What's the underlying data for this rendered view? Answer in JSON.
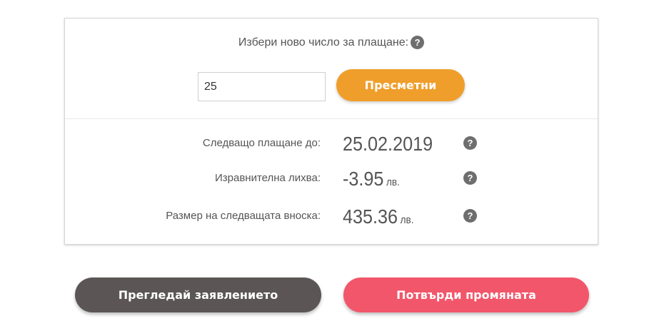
{
  "form": {
    "prompt": "Избери ново число за плащане:",
    "help_glyph": "?",
    "input_value": "25",
    "calculate_label": "Пресметни"
  },
  "summary": {
    "rows": [
      {
        "label": "Следващо плащане до:",
        "value": "25.02.2019",
        "unit": ""
      },
      {
        "label": "Изравнителна лихва:",
        "value": "-3.95",
        "unit": "лв."
      },
      {
        "label": "Размер на следващата вноска:",
        "value": "435.36",
        "unit": "лв."
      }
    ]
  },
  "actions": {
    "review_label": "Прегледай заявлението",
    "confirm_label": "Потвърди промяната"
  },
  "colors": {
    "calculate": "#ef9e2c",
    "review": "#5b5655",
    "confirm": "#f2566a",
    "help": "#6e6e6e"
  }
}
